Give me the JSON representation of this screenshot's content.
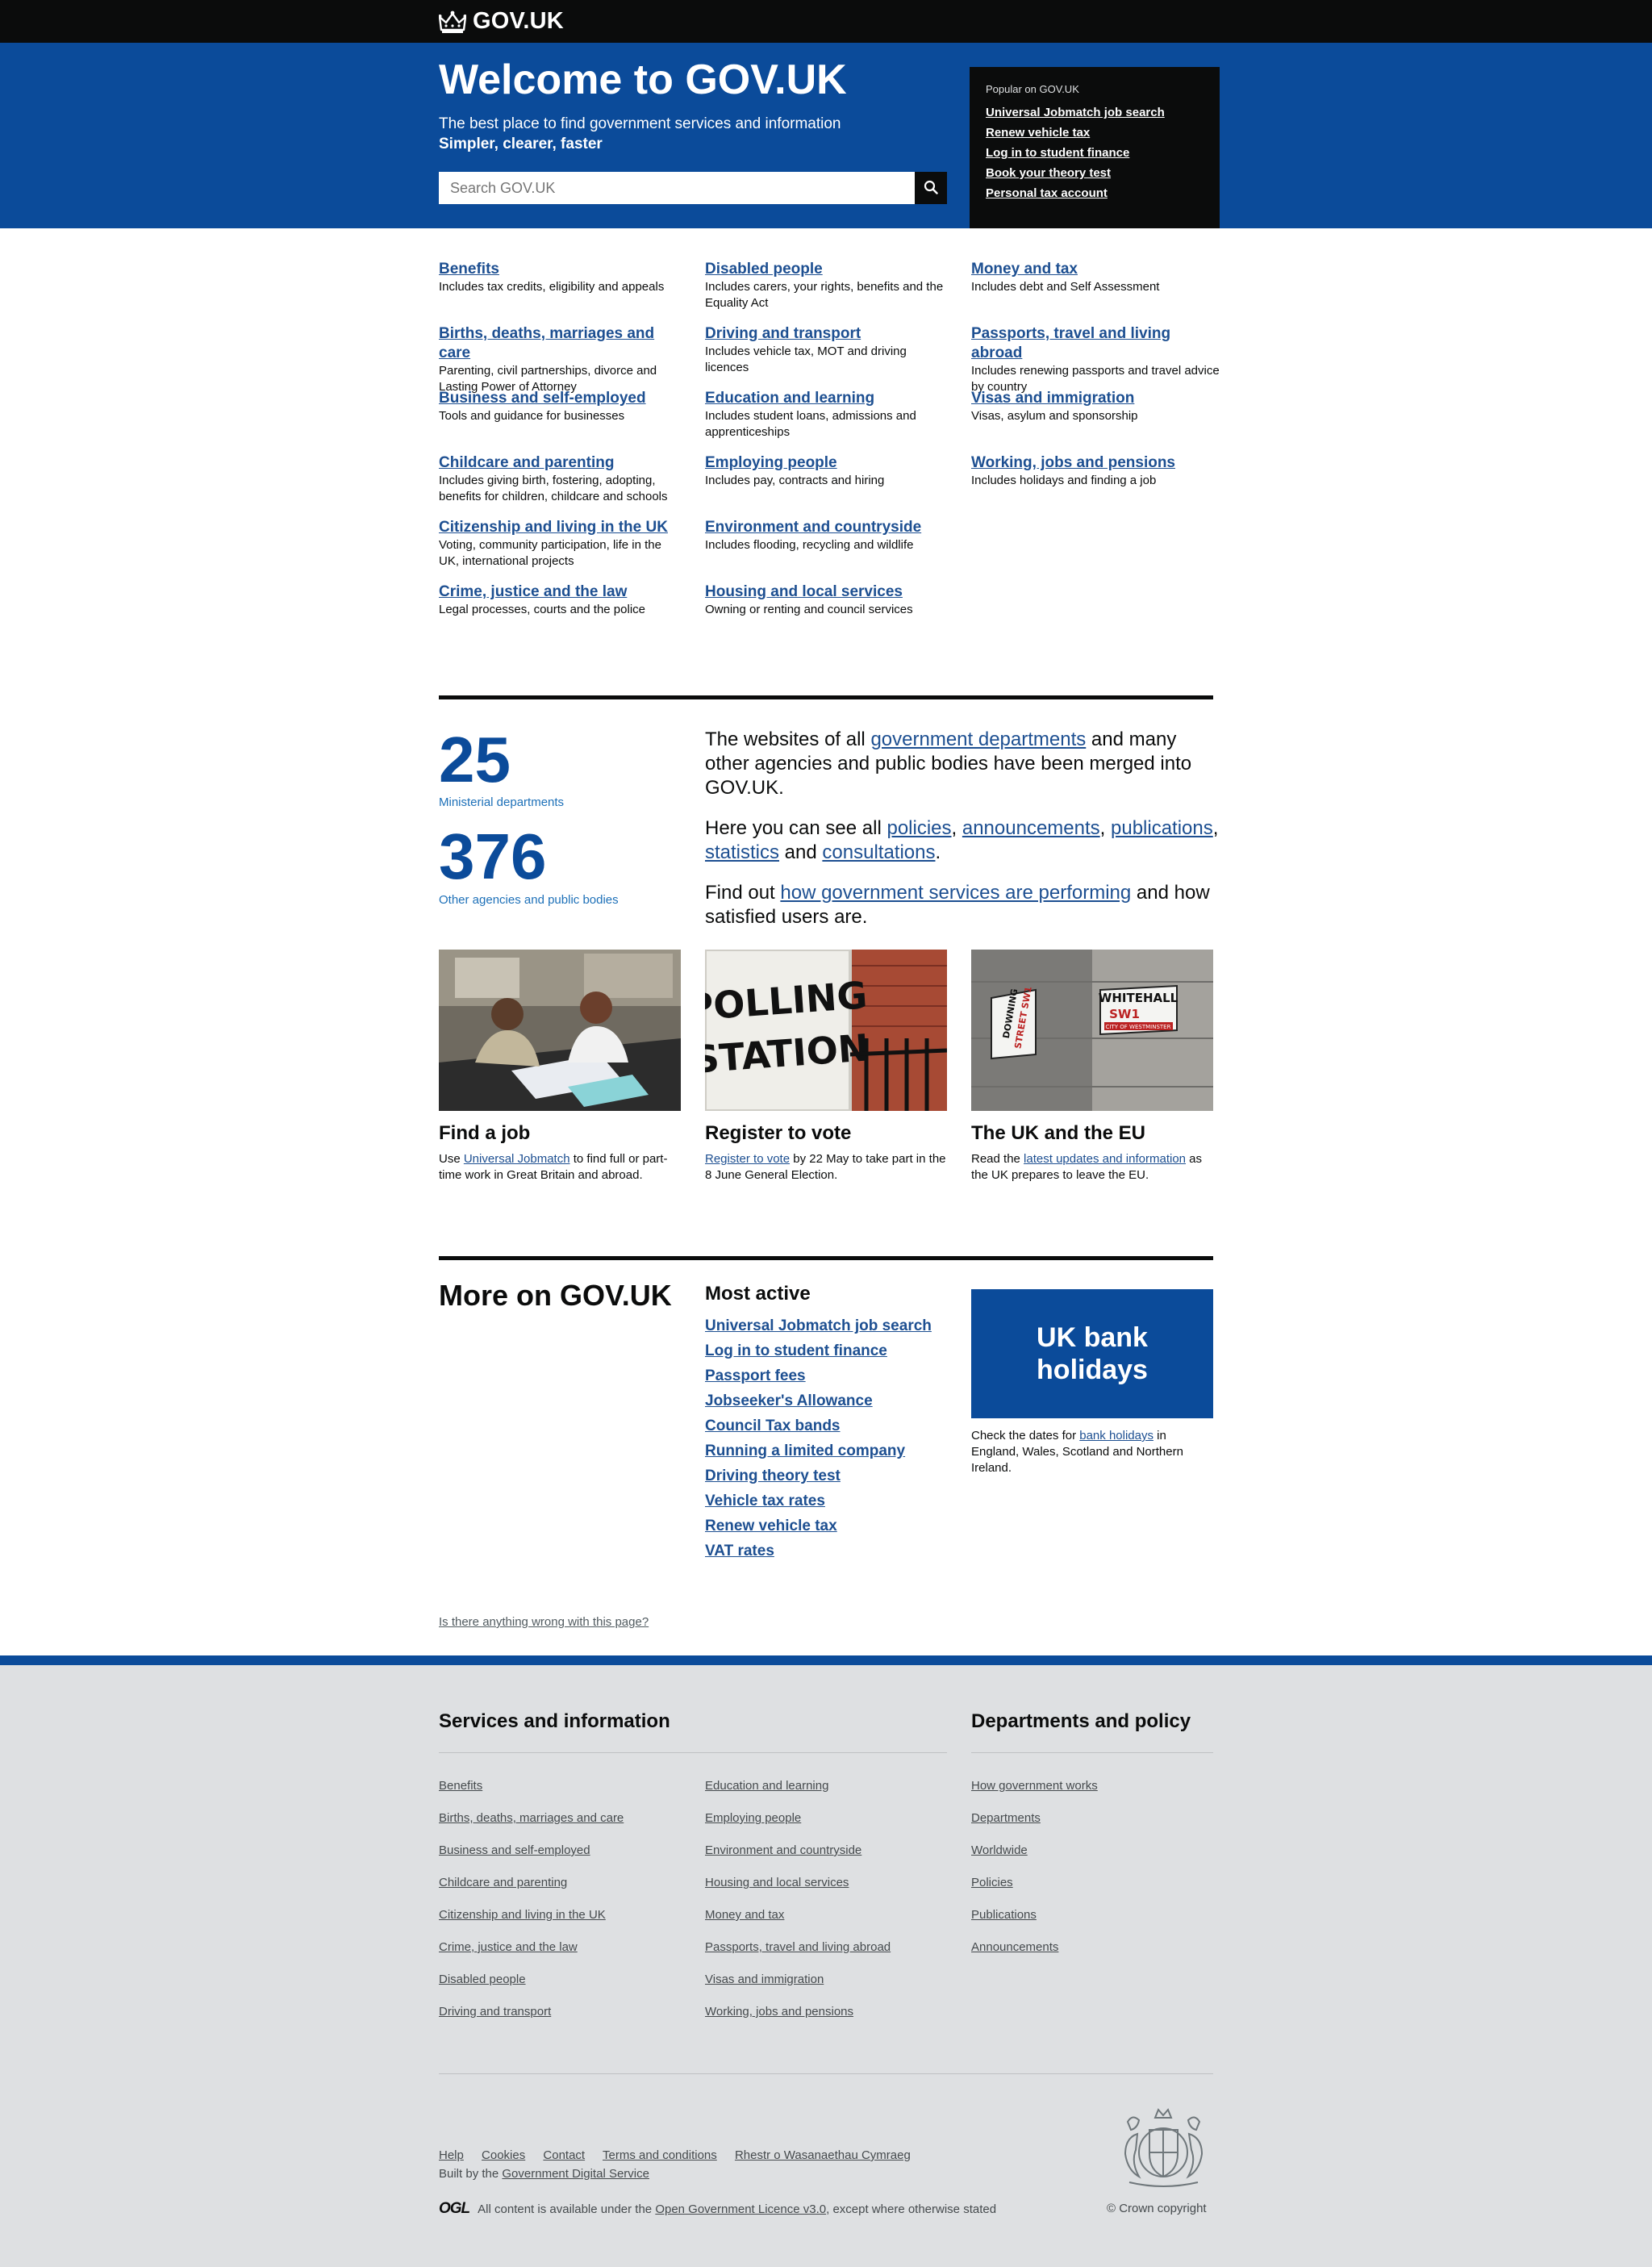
{
  "header": {
    "logo_text": "GOV.UK"
  },
  "hero": {
    "title": "Welcome to GOV.UK",
    "subtitle": "The best place to find government services and information",
    "tagline": "Simpler, clearer, faster",
    "search_placeholder": "Search GOV.UK"
  },
  "popular": {
    "heading": "Popular on GOV.UK",
    "links": [
      "Universal Jobmatch job search",
      "Renew vehicle tax",
      "Log in to student finance",
      "Book your theory test",
      "Personal tax account"
    ]
  },
  "topics": [
    {
      "title": "Benefits",
      "desc": "Includes tax credits, eligibility and appeals"
    },
    {
      "title": "Disabled people",
      "desc": "Includes carers, your rights, benefits and the Equality Act"
    },
    {
      "title": "Money and tax",
      "desc": "Includes debt and Self Assessment"
    },
    {
      "title": "Births, deaths, marriages and care",
      "desc": "Parenting, civil partnerships, divorce and Lasting Power of Attorney"
    },
    {
      "title": "Driving and transport",
      "desc": "Includes vehicle tax, MOT and driving licences"
    },
    {
      "title": "Passports, travel and living abroad",
      "desc": "Includes renewing passports and travel advice by country"
    },
    {
      "title": "Business and self-employed",
      "desc": "Tools and guidance for businesses"
    },
    {
      "title": "Education and learning",
      "desc": "Includes student loans, admissions and apprenticeships"
    },
    {
      "title": "Visas and immigration",
      "desc": "Visas, asylum and sponsorship"
    },
    {
      "title": "Childcare and parenting",
      "desc": "Includes giving birth, fostering, adopting, benefits for children, childcare and schools"
    },
    {
      "title": "Employing people",
      "desc": "Includes pay, contracts and hiring"
    },
    {
      "title": "Working, jobs and pensions",
      "desc": "Includes holidays and finding a job"
    },
    {
      "title": "Citizenship and living in the UK",
      "desc": "Voting, community participation, life in the UK, international projects"
    },
    {
      "title": "Environment and countryside",
      "desc": "Includes flooding, recycling and wildlife"
    },
    {
      "title": "Crime, justice and the law",
      "desc": "Legal processes, courts and the police"
    },
    {
      "title": "Housing and local services",
      "desc": "Owning or renting and council services"
    }
  ],
  "stats": {
    "ministerial_count": "25",
    "ministerial_label": "Ministerial departments",
    "other_count": "376",
    "other_label": "Other agencies and public bodies"
  },
  "about": {
    "p1_pre": "The websites of all ",
    "p1_link": "government departments",
    "p1_post": " and many other agencies and public bodies have been merged into GOV.UK.",
    "p2_pre": "Here you can see all ",
    "p2_link1": "policies",
    "p2_sep1": ", ",
    "p2_link2": "announcements",
    "p2_sep2": ", ",
    "p2_link3": "publications",
    "p2_sep3": ", ",
    "p2_link4": "statistics",
    "p2_sep4": " and ",
    "p2_link5": "consultations",
    "p2_end": ".",
    "p3_pre": "Find out ",
    "p3_link": "how government services are performing",
    "p3_post": " and how satisfied users are."
  },
  "promos": [
    {
      "title": "Find a job",
      "pre": "Use ",
      "link": "Universal Jobmatch",
      "post": " to find full or part-time work in Great Britain and abroad."
    },
    {
      "title": "Register to vote",
      "pre": "",
      "link": "Register to vote",
      "post": " by 22 May to take part in the 8 June General Election.",
      "sign_line1": "POLLING",
      "sign_line2": "STATION"
    },
    {
      "title": "The UK and the EU",
      "pre": "Read the ",
      "link": "latest updates and information",
      "post": " as the UK prepares to leave the EU.",
      "sign_a1": "DOWNING",
      "sign_a2": "STREET SW1",
      "sign_b1": "WHITEHALL",
      "sign_b2": "SW1",
      "sign_b3": "CITY OF WESTMINSTER"
    }
  ],
  "more": {
    "title": "More on GOV.UK",
    "most_active_title": "Most active",
    "most_active": [
      "Universal Jobmatch job search",
      "Log in to student finance",
      "Passport fees",
      "Jobseeker's Allowance",
      "Council Tax bands",
      "Running a limited company",
      "Driving theory test",
      "Vehicle tax rates",
      "Renew vehicle tax",
      "VAT rates"
    ],
    "bank_title_1": "UK bank",
    "bank_title_2": "holidays",
    "bank_pre": "Check the dates for ",
    "bank_link": "bank holidays",
    "bank_post": " in England, Wales, Scotland and Northern Ireland."
  },
  "report_link": "Is there anything wrong with this page?",
  "footer": {
    "services_title": "Services and information",
    "services_col1": [
      "Benefits",
      "Births, deaths, marriages and care",
      "Business and self-employed",
      "Childcare and parenting",
      "Citizenship and living in the UK",
      "Crime, justice and the law",
      "Disabled people",
      "Driving and transport"
    ],
    "services_col2": [
      "Education and learning",
      "Employing people",
      "Environment and countryside",
      "Housing and local services",
      "Money and tax",
      "Passports, travel and living abroad",
      "Visas and immigration",
      "Working, jobs and pensions"
    ],
    "departments_title": "Departments and policy",
    "departments": [
      "How government works",
      "Departments",
      "Worldwide",
      "Policies",
      "Publications",
      "Announcements"
    ],
    "meta_links": [
      "Help",
      "Cookies",
      "Contact",
      "Terms and conditions",
      "Rhestr o Wasanaethau Cymraeg"
    ],
    "built_pre": "Built by the ",
    "built_link": "Government Digital Service",
    "ogl_logo": "OGL",
    "licence_pre": "All content is available under the ",
    "licence_link": "Open Government Licence v3.0",
    "licence_post": ", except where otherwise stated",
    "copyright": "© Crown copyright"
  },
  "colors": {
    "brand_blue": "#0b4b9a",
    "link": "#1d4f91",
    "black": "#0b0c0c",
    "footer_bg": "#dee0e2"
  },
  "icons": {
    "logo": "crown-icon",
    "search": "search-icon",
    "crest": "royal-coat-of-arms-icon"
  }
}
